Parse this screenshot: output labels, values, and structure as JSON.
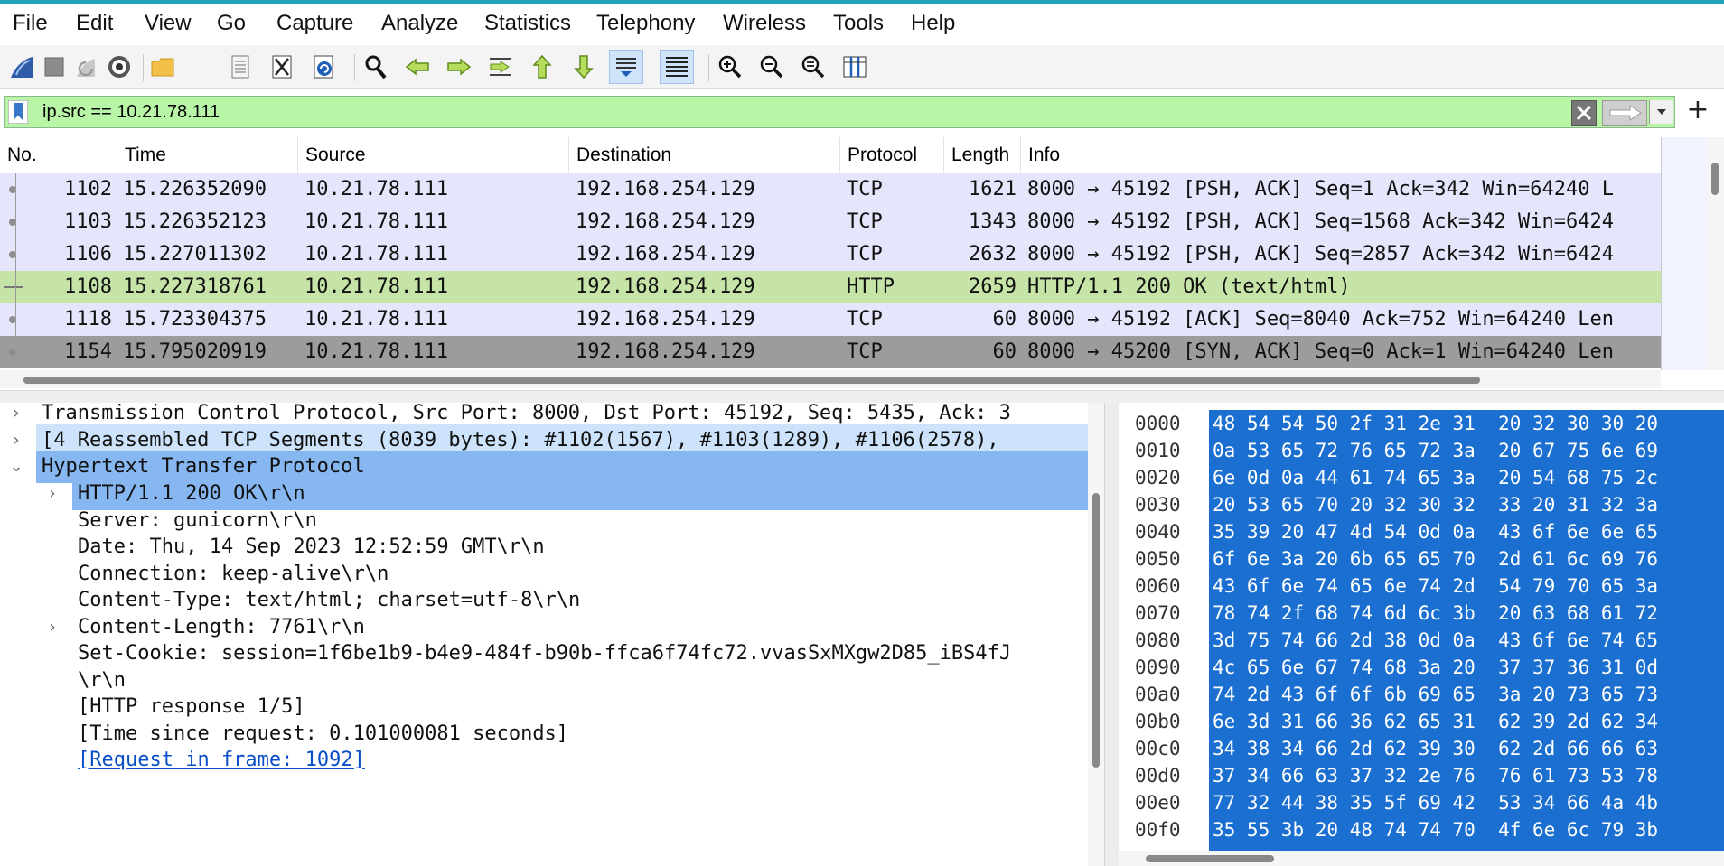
{
  "menu": [
    "File",
    "Edit",
    "View",
    "Go",
    "Capture",
    "Analyze",
    "Statistics",
    "Telephony",
    "Wireless",
    "Tools",
    "Help"
  ],
  "toolbar": {
    "icons": [
      "shark-fin-start-icon",
      "stop-capture-icon",
      "restart-capture-icon",
      "capture-options-icon",
      "open-folder-icon",
      "file-icon",
      "close-file-icon",
      "reload-icon",
      "find-packet-icon",
      "go-back-icon",
      "go-forward-icon",
      "go-to-packet-icon",
      "first-packet-icon",
      "last-packet-icon",
      "autoscroll-icon",
      "colorize-icon",
      "zoom-in-icon",
      "zoom-out-icon",
      "zoom-normal-icon",
      "resize-columns-icon"
    ]
  },
  "filter": {
    "value": "ip.src == 10.21.78.111"
  },
  "packet_list": {
    "columns": [
      "No.",
      "Time",
      "Source",
      "Destination",
      "Protocol",
      "Length",
      "Info"
    ],
    "rows": [
      {
        "no": "1102",
        "time": "15.226352090",
        "src": "10.21.78.111",
        "dst": "192.168.254.129",
        "proto": "TCP",
        "len": "1621",
        "info": "8000 → 45192 [PSH, ACK] Seq=1 Ack=342 Win=64240 L",
        "kind": "tcp"
      },
      {
        "no": "1103",
        "time": "15.226352123",
        "src": "10.21.78.111",
        "dst": "192.168.254.129",
        "proto": "TCP",
        "len": "1343",
        "info": "8000 → 45192 [PSH, ACK] Seq=1568 Ack=342 Win=6424",
        "kind": "tcp"
      },
      {
        "no": "1106",
        "time": "15.227011302",
        "src": "10.21.78.111",
        "dst": "192.168.254.129",
        "proto": "TCP",
        "len": "2632",
        "info": "8000 → 45192 [PSH, ACK] Seq=2857 Ack=342 Win=6424",
        "kind": "tcp"
      },
      {
        "no": "1108",
        "time": "15.227318761",
        "src": "10.21.78.111",
        "dst": "192.168.254.129",
        "proto": "HTTP",
        "len": "2659",
        "info": "HTTP/1.1 200 OK  (text/html)",
        "kind": "http"
      },
      {
        "no": "1118",
        "time": "15.723304375",
        "src": "10.21.78.111",
        "dst": "192.168.254.129",
        "proto": "TCP",
        "len": "60",
        "info": "8000 → 45192 [ACK] Seq=8040 Ack=752 Win=64240 Len",
        "kind": "tcp"
      },
      {
        "no": "1154",
        "time": "15.795020919",
        "src": "10.21.78.111",
        "dst": "192.168.254.129",
        "proto": "TCP",
        "len": "60",
        "info": "8000 → 45200 [SYN, ACK] Seq=0 Ack=1 Win=64240 Len",
        "kind": "sel"
      }
    ]
  },
  "details": [
    {
      "text": "Transmission Control Protocol, Src Port: 8000, Dst Port: 45192, Seq: 5435, Ack: 3",
      "indent": 0,
      "arrow": "›",
      "hl": ""
    },
    {
      "text": "[4 Reassembled TCP Segments (8039 bytes): #1102(1567), #1103(1289), #1106(2578),",
      "indent": 0,
      "arrow": "›",
      "hl": "hl1"
    },
    {
      "text": "Hypertext Transfer Protocol",
      "indent": 0,
      "arrow": "⌄",
      "hl": "hl2"
    },
    {
      "text": "HTTP/1.1 200 OK\\r\\n",
      "indent": 1,
      "arrow": "›",
      "hl": "hl2"
    },
    {
      "text": "Server: gunicorn\\r\\n",
      "indent": 1,
      "arrow": "",
      "hl": ""
    },
    {
      "text": "Date: Thu, 14 Sep 2023 12:52:59 GMT\\r\\n",
      "indent": 1,
      "arrow": "",
      "hl": ""
    },
    {
      "text": "Connection: keep-alive\\r\\n",
      "indent": 1,
      "arrow": "",
      "hl": ""
    },
    {
      "text": "Content-Type: text/html; charset=utf-8\\r\\n",
      "indent": 1,
      "arrow": "",
      "hl": ""
    },
    {
      "text": "Content-Length: 7761\\r\\n",
      "indent": 1,
      "arrow": "›",
      "hl": ""
    },
    {
      "text": "Set-Cookie: session=1f6be1b9-b4e9-484f-b90b-ffca6f74fc72.vvasSxMXgw2D85_iBS4fJ",
      "indent": 1,
      "arrow": "",
      "hl": ""
    },
    {
      "text": "\\r\\n",
      "indent": 1,
      "arrow": "",
      "hl": ""
    },
    {
      "text": "[HTTP response 1/5]",
      "indent": 1,
      "arrow": "",
      "hl": ""
    },
    {
      "text": "[Time since request: 0.101000081 seconds]",
      "indent": 1,
      "arrow": "",
      "hl": ""
    },
    {
      "text": "[Request in frame: 1092]",
      "indent": 1,
      "arrow": "",
      "hl": "",
      "link": true
    }
  ],
  "bytes": [
    {
      "off": "0000",
      "hex": "48 54 54 50 2f 31 2e 31  20 32 30 30 20"
    },
    {
      "off": "0010",
      "hex": "0a 53 65 72 76 65 72 3a  20 67 75 6e 69"
    },
    {
      "off": "0020",
      "hex": "6e 0d 0a 44 61 74 65 3a  20 54 68 75 2c"
    },
    {
      "off": "0030",
      "hex": "20 53 65 70 20 32 30 32  33 20 31 32 3a"
    },
    {
      "off": "0040",
      "hex": "35 39 20 47 4d 54 0d 0a  43 6f 6e 6e 65"
    },
    {
      "off": "0050",
      "hex": "6f 6e 3a 20 6b 65 65 70  2d 61 6c 69 76"
    },
    {
      "off": "0060",
      "hex": "43 6f 6e 74 65 6e 74 2d  54 79 70 65 3a"
    },
    {
      "off": "0070",
      "hex": "78 74 2f 68 74 6d 6c 3b  20 63 68 61 72"
    },
    {
      "off": "0080",
      "hex": "3d 75 74 66 2d 38 0d 0a  43 6f 6e 74 65"
    },
    {
      "off": "0090",
      "hex": "4c 65 6e 67 74 68 3a 20  37 37 36 31 0d"
    },
    {
      "off": "00a0",
      "hex": "74 2d 43 6f 6f 6b 69 65  3a 20 73 65 73"
    },
    {
      "off": "00b0",
      "hex": "6e 3d 31 66 36 62 65 31  62 39 2d 62 34"
    },
    {
      "off": "00c0",
      "hex": "34 38 34 66 2d 62 39 30  62 2d 66 66 63"
    },
    {
      "off": "00d0",
      "hex": "37 34 66 63 37 32 2e 76  76 61 73 53 78"
    },
    {
      "off": "00e0",
      "hex": "77 32 44 38 35 5f 69 42  53 34 66 4a 4b"
    },
    {
      "off": "00f0",
      "hex": "35 55 3b 20 48 74 74 70  4f 6e 6c 79 3b"
    }
  ],
  "colors": {
    "tcp_row": "#e5e5fc",
    "http_row": "#c6e4a8",
    "selected_row": "#9c9c9c",
    "filter_bg": "#b9f5a7",
    "bytes_hl": "#1a6fd1"
  }
}
